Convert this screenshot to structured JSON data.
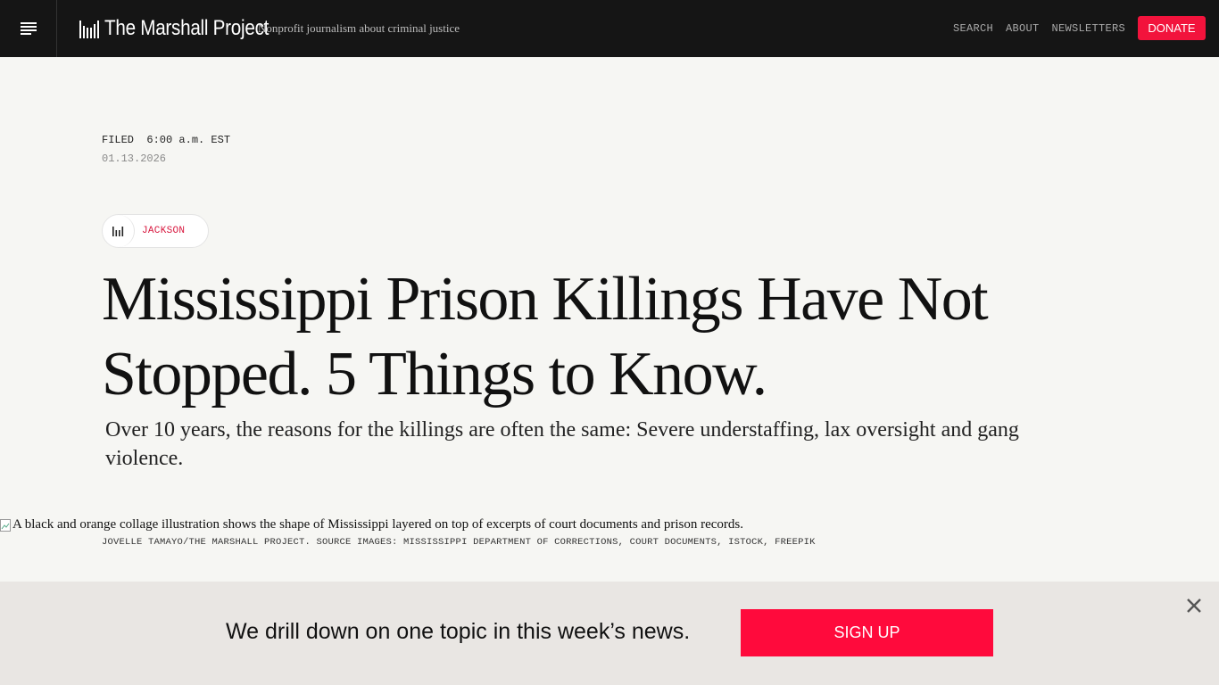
{
  "header": {
    "menu_icon": "hamburger-menu-icon",
    "logo_text": "The Marshall Project",
    "logo_icon": "bars-logo-icon",
    "tagline": "Nonprofit journalism about criminal justice",
    "nav": [
      "SEARCH",
      "ABOUT",
      "NEWSLETTERS"
    ],
    "donate_label": "DONATE",
    "background_color": "#151515",
    "accent_color": "#f2133c"
  },
  "article": {
    "filed_label": "FILED  6:00 a.m. EST",
    "date": "01.13.2026",
    "tag": {
      "icon": "bars-logo-icon",
      "label": "JACKSON"
    },
    "headline": "Mississippi Prison Killings Have Not Stopped. 5 Things to Know.",
    "dek": "Over 10 years, the reasons for the killings are often the same: Severe understaffing, lax oversight and gang violence.",
    "image_alt": "A black and orange collage illustration shows the shape of Mississippi layered on top of excerpts of court documents and prison records.",
    "image_credit": "JOVELLE TAMAYO/THE MARSHALL PROJECT. SOURCE IMAGES: MISSISSIPPI DEPARTMENT OF CORRECTIONS, COURT DOCUMENTS, ISTOCK, FREEPIK"
  },
  "newsletter_banner": {
    "text": "We drill down on one topic in this week’s news.",
    "button_label": "SIGN UP",
    "close_icon": "close-icon",
    "button_color": "#ff0a3c",
    "background_color": "#e9e6e3"
  }
}
